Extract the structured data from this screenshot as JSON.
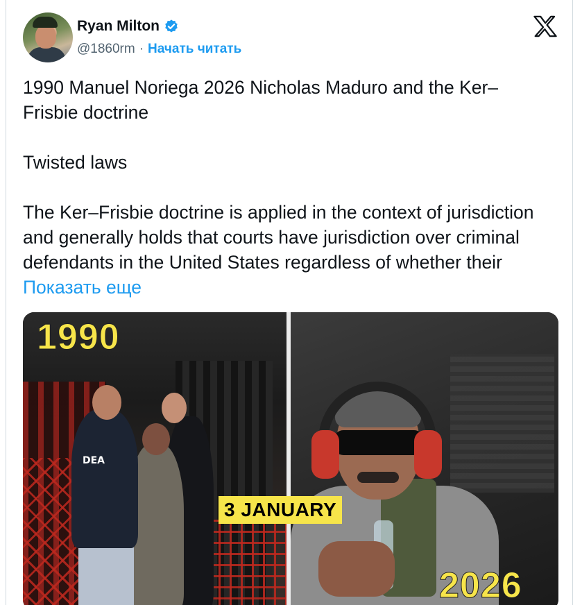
{
  "author": {
    "name": "Ryan Milton",
    "handle": "@1860rm",
    "separator": "·",
    "follow_label": "Начать читать"
  },
  "tweet": {
    "paragraphs": [
      "1990 Manuel Noriega 2026 Nicholas Maduro and the Ker–Frisbie doctrine",
      "Twisted laws",
      "The Ker–Frisbie doctrine is applied in the context of jurisdiction and generally holds that courts have jurisdiction over criminal defendants in the United States regardless of whether their"
    ],
    "show_more_label": "Показать еще"
  },
  "media": {
    "left_year": "1990",
    "right_year": "2026",
    "center_label": "3 JANUARY",
    "jacket_text": "DEA"
  },
  "colors": {
    "accent": "#1d9bf0",
    "text": "#0f1419",
    "muted": "#536471",
    "overlay_yellow": "#f7e54a"
  },
  "icons": {
    "verified": "verified-badge-icon",
    "platform": "x-logo-icon"
  }
}
